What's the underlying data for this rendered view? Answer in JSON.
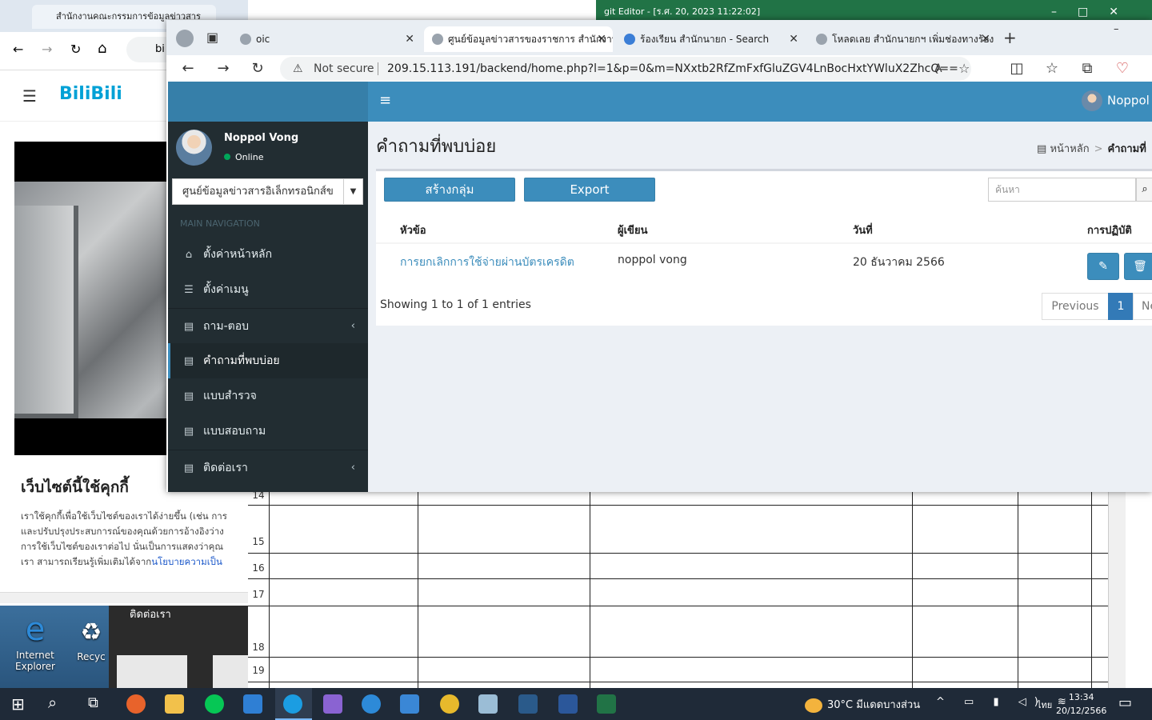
{
  "background": {
    "excel": {
      "title": "git Editor - [ร.ศ. 20, 2023 11:22:02]",
      "row_numbers": [
        "14",
        "15",
        "16",
        "17",
        "18",
        "19"
      ]
    },
    "left_browser": {
      "tab_title": "สำนักงานคณะกรรมการข้อมูลข่าวสาร",
      "address_fragment": "bi",
      "site_logo": "BiliBili",
      "cookie_title": "เว็บไซต์นี้ใช้คุกกี้",
      "cookie_lines": [
        "เราใช้คุกกี้เพื่อใช้เว็บไซต์ของเราได้ง่ายขึ้น (เช่น การ",
        "และปรับปรุงประสบการณ์ของคุณด้วยการอ้างอิงว่าง",
        "การใช้เว็บไซต์ของเราต่อไป นั่นเป็นการแสดงว่าคุณ"
      ],
      "cookie_last_prefix": "เรา สามารถเรียนรู้เพิ่มเติมได้จาก",
      "cookie_link": "นโยบายความเป็น"
    },
    "desktop": {
      "icon_ie": "Internet Explorer",
      "icon_recycle": "Recyc",
      "thumb_label": "ติดต่อเรา"
    }
  },
  "browser": {
    "tabs": [
      {
        "title": "oic",
        "active": false
      },
      {
        "title": "ศูนย์ข้อมูลข่าวสารของราชการ สำนักงาน",
        "active": true
      },
      {
        "title": "ร้องเรียน สำนักนายก - Search",
        "active": false
      },
      {
        "title": "โหลดเลย สำนักนายกฯ เพิ่มช่องทางร้อง",
        "active": false
      }
    ],
    "not_secure": "Not secure",
    "url": "209.15.113.191/backend/home.php?l=1&p=0&m=NXxtb2RfZmFxfGluZGV4LnBocHxtYWluX2ZhcQ=="
  },
  "app": {
    "header_user": "Noppol",
    "sidebar": {
      "user_name": "Noppol Vong",
      "status": "Online",
      "org_select": "ศูนย์ข้อมูลข่าวสารอิเล็กทรอนิกส์ข",
      "nav_label": "MAIN NAVIGATION",
      "items": [
        {
          "label": "ตั้งค่าหน้าหลัก",
          "icon": "home-icon",
          "submenu": false,
          "active": false
        },
        {
          "label": "ตั้งค่าเมนู",
          "icon": "list-icon",
          "submenu": false,
          "active": false
        },
        {
          "label": "ถาม-ตอบ",
          "icon": "newspaper-icon",
          "submenu": true,
          "active": false
        },
        {
          "label": "คำถามที่พบบ่อย",
          "icon": "newspaper-icon",
          "submenu": false,
          "active": true
        },
        {
          "label": "แบบสำรวจ",
          "icon": "newspaper-icon",
          "submenu": false,
          "active": false
        },
        {
          "label": "แบบสอบถาม",
          "icon": "newspaper-icon",
          "submenu": false,
          "active": false
        },
        {
          "label": "ติดต่อเรา",
          "icon": "newspaper-icon",
          "submenu": true,
          "active": false
        }
      ]
    },
    "page_title": "คำถามที่พบบ่อย",
    "breadcrumb": {
      "home": "หน้าหลัก",
      "current": "คำถามที่"
    },
    "buttons": {
      "create_group": "สร้างกลุ่ม",
      "export": "Export"
    },
    "search": {
      "placeholder": "ค้นหา"
    },
    "table": {
      "headers": [
        "หัวข้อ",
        "ผู้เขียน",
        "วันที่",
        "การปฏิบัติ"
      ],
      "rows": [
        {
          "title": "การยกเลิกการใช้จ่ายผ่านบัตรเครดิต",
          "author": "noppol vong",
          "date": "20 ธันวาคม 2566"
        }
      ]
    },
    "info": "Showing 1 to 1 of 1 entries",
    "pagination": {
      "previous": "Previous",
      "current": "1",
      "next": "Ne"
    }
  },
  "taskbar": {
    "weather": "30°C  มีแดดบางส่วน",
    "lang": "ไทย",
    "time": "13:34",
    "date": "20/12/2566"
  }
}
